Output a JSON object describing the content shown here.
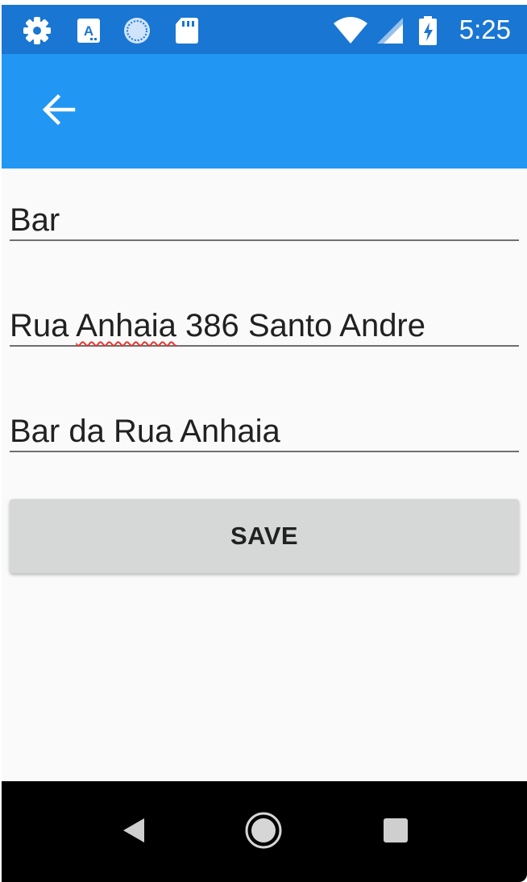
{
  "status_bar": {
    "time": "5:25",
    "icons": [
      "settings-icon",
      "keyboard-a-icon",
      "sync-circle-icon",
      "sd-card-icon",
      "wifi-icon",
      "cell-signal-icon",
      "battery-charging-icon"
    ],
    "color": "#1976d2"
  },
  "app_bar": {
    "back_icon": "arrow-back-icon",
    "color": "#2196f3"
  },
  "form": {
    "field_1_value": "Bar",
    "field_2_value_prefix": "Rua ",
    "field_2_value_misspelled": "Anhaia",
    "field_2_value_suffix": " 386 Santo Andre",
    "field_3_value": "Bar da Rua Anhaia"
  },
  "save_button": {
    "label": "SAVE"
  },
  "nav_bar": {
    "icons": [
      "nav-back-icon",
      "nav-home-icon",
      "nav-recents-icon"
    ]
  }
}
